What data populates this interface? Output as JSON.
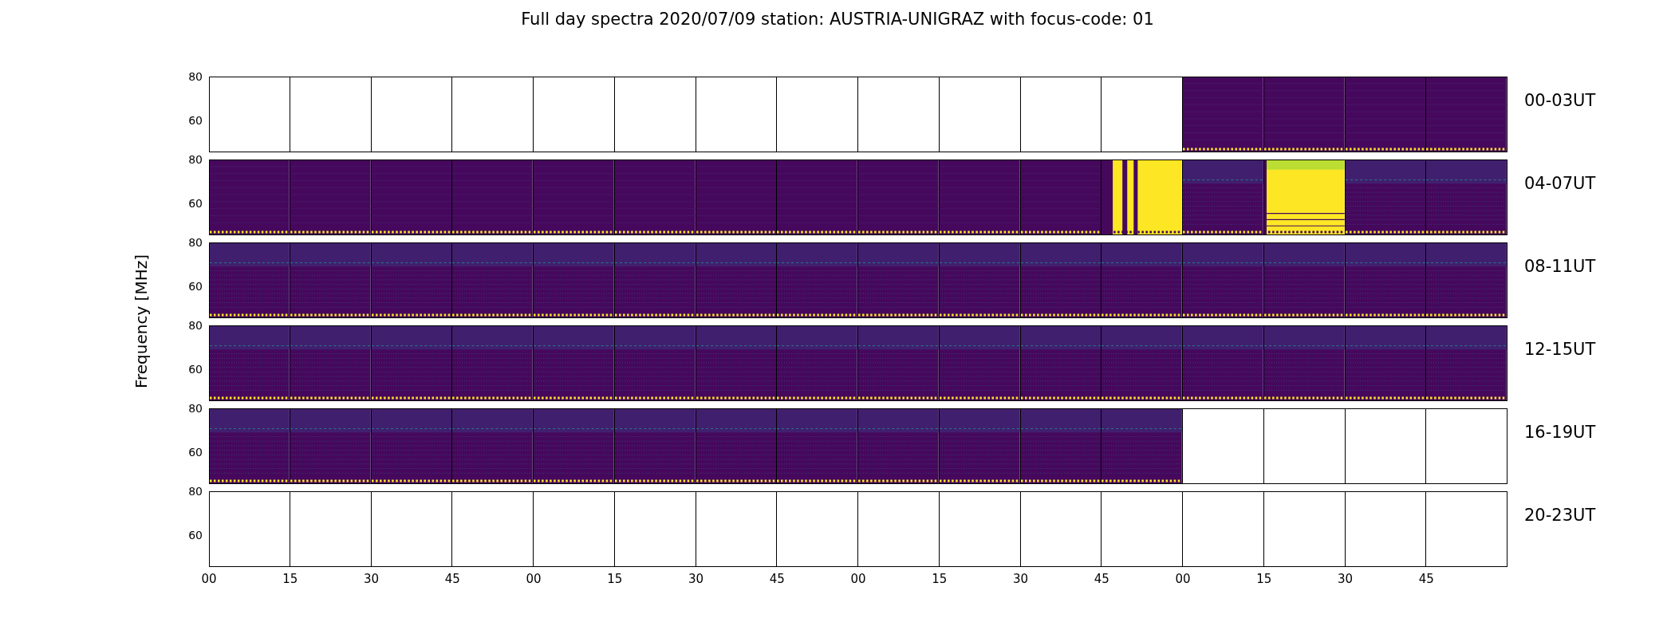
{
  "title": "Full day spectra 2020/07/09 station: AUSTRIA-UNIGRAZ with focus-code: 01",
  "ylabel": "Frequency [MHz]",
  "rows": [
    {
      "label": "00-03UT",
      "yticks": [
        "80",
        "60"
      ],
      "panels": [
        {
          "kind": "empty"
        },
        {
          "kind": "empty"
        },
        {
          "kind": "empty"
        },
        {
          "kind": "empty"
        },
        {
          "kind": "empty"
        },
        {
          "kind": "empty"
        },
        {
          "kind": "empty"
        },
        {
          "kind": "empty"
        },
        {
          "kind": "empty"
        },
        {
          "kind": "empty"
        },
        {
          "kind": "empty"
        },
        {
          "kind": "empty"
        },
        {
          "kind": "quiet"
        },
        {
          "kind": "quiet"
        },
        {
          "kind": "quiet"
        },
        {
          "kind": "quiet"
        }
      ]
    },
    {
      "label": "04-07UT",
      "yticks": [
        "80",
        "60"
      ],
      "panels": [
        {
          "kind": "quiet"
        },
        {
          "kind": "quiet"
        },
        {
          "kind": "quiet"
        },
        {
          "kind": "quiet"
        },
        {
          "kind": "quiet"
        },
        {
          "kind": "quiet"
        },
        {
          "kind": "quiet"
        },
        {
          "kind": "quiet"
        },
        {
          "kind": "quiet"
        },
        {
          "kind": "quiet"
        },
        {
          "kind": "quiet"
        },
        {
          "kind": "banded-burst"
        },
        {
          "kind": "active"
        },
        {
          "kind": "burst"
        },
        {
          "kind": "active"
        },
        {
          "kind": "active"
        }
      ]
    },
    {
      "label": "08-11UT",
      "yticks": [
        "80",
        "60"
      ],
      "panels": [
        {
          "kind": "active"
        },
        {
          "kind": "active"
        },
        {
          "kind": "active"
        },
        {
          "kind": "active"
        },
        {
          "kind": "active"
        },
        {
          "kind": "active"
        },
        {
          "kind": "active"
        },
        {
          "kind": "active"
        },
        {
          "kind": "active"
        },
        {
          "kind": "active"
        },
        {
          "kind": "active"
        },
        {
          "kind": "active"
        },
        {
          "kind": "active"
        },
        {
          "kind": "active"
        },
        {
          "kind": "active"
        },
        {
          "kind": "active"
        }
      ]
    },
    {
      "label": "12-15UT",
      "yticks": [
        "80",
        "60"
      ],
      "panels": [
        {
          "kind": "active"
        },
        {
          "kind": "active"
        },
        {
          "kind": "active"
        },
        {
          "kind": "active"
        },
        {
          "kind": "active"
        },
        {
          "kind": "active"
        },
        {
          "kind": "active"
        },
        {
          "kind": "active"
        },
        {
          "kind": "active"
        },
        {
          "kind": "active"
        },
        {
          "kind": "active"
        },
        {
          "kind": "active"
        },
        {
          "kind": "active"
        },
        {
          "kind": "active"
        },
        {
          "kind": "active"
        },
        {
          "kind": "active"
        }
      ]
    },
    {
      "label": "16-19UT",
      "yticks": [
        "80",
        "60"
      ],
      "panels": [
        {
          "kind": "active"
        },
        {
          "kind": "active"
        },
        {
          "kind": "active"
        },
        {
          "kind": "active"
        },
        {
          "kind": "active"
        },
        {
          "kind": "active"
        },
        {
          "kind": "active"
        },
        {
          "kind": "active"
        },
        {
          "kind": "active"
        },
        {
          "kind": "active"
        },
        {
          "kind": "active"
        },
        {
          "kind": "active"
        },
        {
          "kind": "empty"
        },
        {
          "kind": "empty"
        },
        {
          "kind": "empty"
        },
        {
          "kind": "empty"
        }
      ]
    },
    {
      "label": "20-23UT",
      "yticks": [
        "80",
        "60"
      ],
      "panels": [
        {
          "kind": "empty"
        },
        {
          "kind": "empty"
        },
        {
          "kind": "empty"
        },
        {
          "kind": "empty"
        },
        {
          "kind": "empty"
        },
        {
          "kind": "empty"
        },
        {
          "kind": "empty"
        },
        {
          "kind": "empty"
        },
        {
          "kind": "empty"
        },
        {
          "kind": "empty"
        },
        {
          "kind": "empty"
        },
        {
          "kind": "empty"
        },
        {
          "kind": "empty"
        },
        {
          "kind": "empty"
        },
        {
          "kind": "empty"
        },
        {
          "kind": "empty"
        }
      ]
    }
  ],
  "xticks": [
    "00",
    "15",
    "30",
    "45",
    "00",
    "15",
    "30",
    "45",
    "00",
    "15",
    "30",
    "45",
    "00",
    "15",
    "30",
    "45"
  ]
}
